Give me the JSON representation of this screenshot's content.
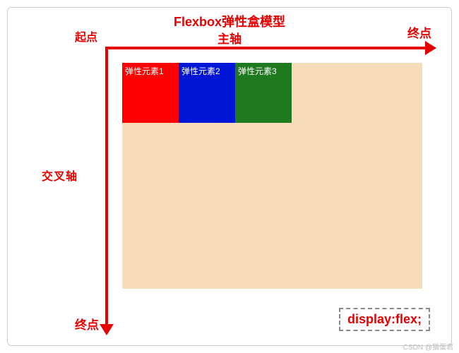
{
  "title": "Flexbox弹性盒模型",
  "main_axis_label": "主轴",
  "cross_axis_label": "交叉轴",
  "start_label": "起点",
  "end_label_h": "终点",
  "end_label_v": "终点",
  "items": {
    "item1": "弹性元素1",
    "item2": "弹性元素2",
    "item3": "弹性元素3"
  },
  "legend": "display:flex;",
  "watermark": "CSDN @猫蛋君",
  "colors": {
    "accent": "#e60000",
    "container_bg": "#f6dcb8",
    "item1": "#ff0000",
    "item2": "#0015d6",
    "item3": "#1f7a1f"
  }
}
